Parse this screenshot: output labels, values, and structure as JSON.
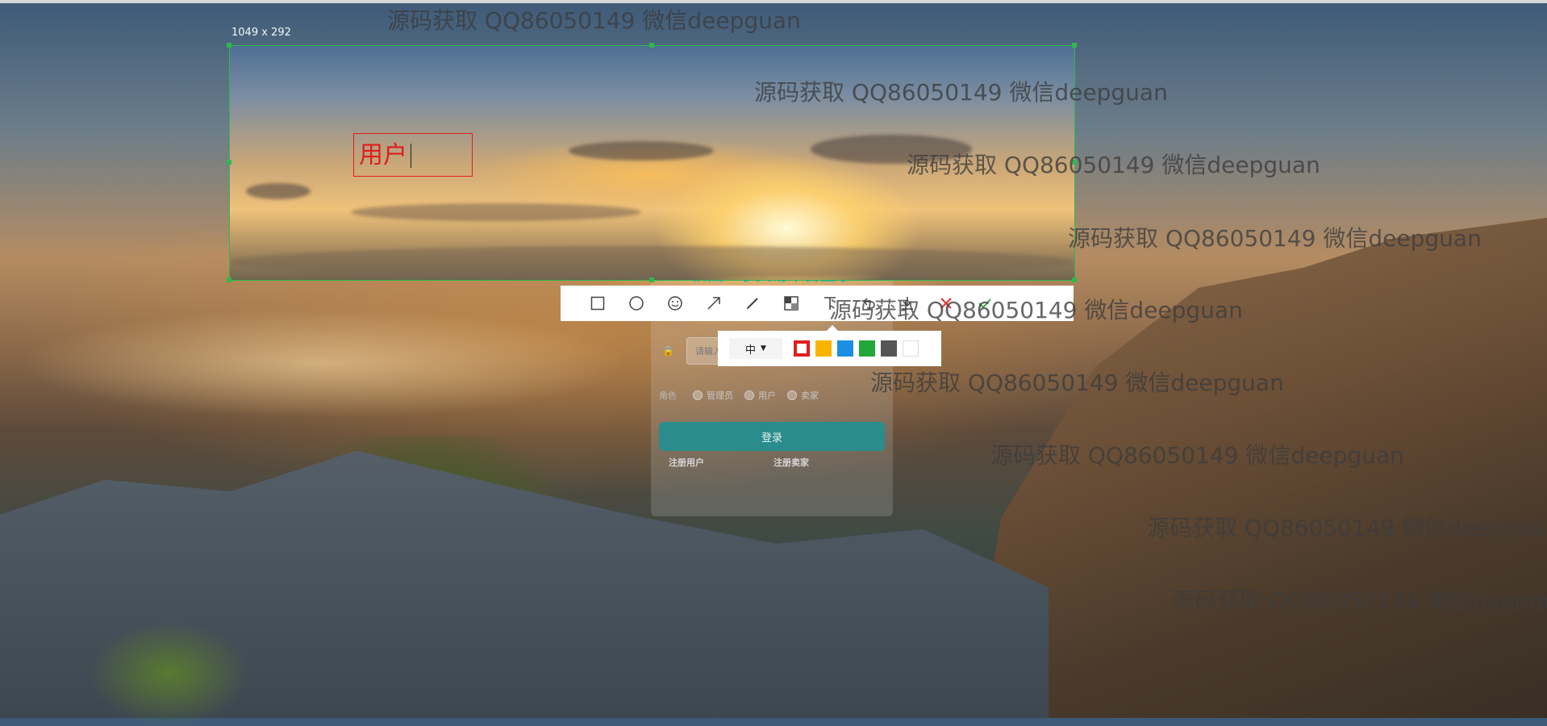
{
  "selection": {
    "size_label": "1049 x 292"
  },
  "annotation": {
    "text": "用户",
    "color": "#e11d1d"
  },
  "login": {
    "title": "校园二手交易平台登录",
    "password_placeholder": "请输入",
    "role_label": "角色",
    "roles": [
      "管理员",
      "用户",
      "卖家"
    ],
    "login_button": "登录",
    "register_user": "注册用户",
    "register_seller": "注册卖家"
  },
  "toolbar": {
    "tools": [
      "rectangle-tool",
      "ellipse-tool",
      "emoji-tool",
      "arrow-tool",
      "pen-tool",
      "mosaic-tool",
      "text-tool",
      "undo-tool",
      "download-tool",
      "cancel-tool",
      "confirm-tool"
    ]
  },
  "palette": {
    "size": "中",
    "colors": [
      "#e11d1d",
      "#f7b500",
      "#1a8fe3",
      "#22a83a",
      "#555555",
      "#ffffff"
    ]
  },
  "watermark": {
    "text": "源码获取 QQ86050149 微信deepguan"
  }
}
